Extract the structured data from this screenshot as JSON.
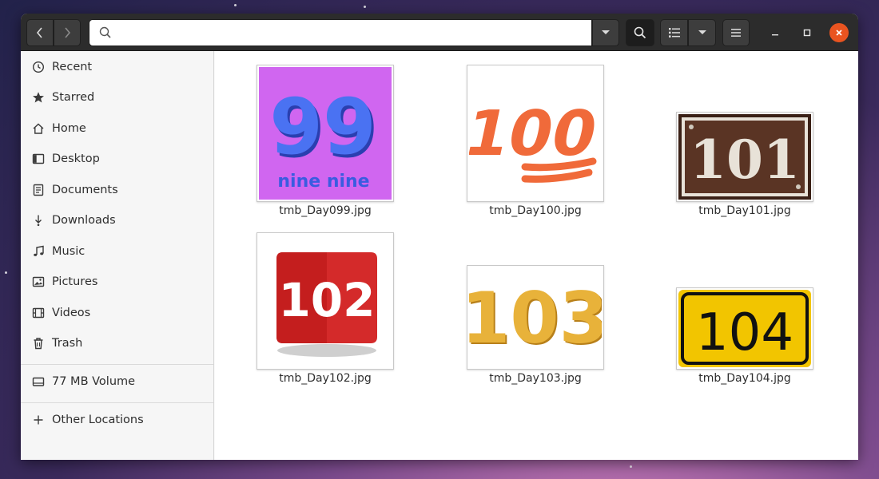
{
  "toolbar": {
    "search_placeholder": ""
  },
  "sidebar": {
    "items": [
      {
        "label": "Recent",
        "icon": "clock-icon"
      },
      {
        "label": "Starred",
        "icon": "star-icon"
      },
      {
        "label": "Home",
        "icon": "home-icon"
      },
      {
        "label": "Desktop",
        "icon": "desktop-icon"
      },
      {
        "label": "Documents",
        "icon": "document-icon"
      },
      {
        "label": "Downloads",
        "icon": "download-icon"
      },
      {
        "label": "Music",
        "icon": "music-icon"
      },
      {
        "label": "Pictures",
        "icon": "pictures-icon"
      },
      {
        "label": "Videos",
        "icon": "video-icon"
      },
      {
        "label": "Trash",
        "icon": "trash-icon"
      }
    ],
    "volume": {
      "label": "77 MB Volume",
      "icon": "drive-icon"
    },
    "other_locations": {
      "label": "Other Locations",
      "icon": "plus-icon"
    }
  },
  "files": [
    {
      "name": "tmb_Day099.jpg",
      "number": "99",
      "caption": "nine nine",
      "bg": "#d066f0",
      "fg": "#3a5ce0"
    },
    {
      "name": "tmb_Day100.jpg",
      "number": "100",
      "bg": "#ffffff",
      "fg": "#f06a3a"
    },
    {
      "name": "tmb_Day101.jpg",
      "number": "101",
      "bg": "#4a2a1c",
      "fg": "#e8e2d8"
    },
    {
      "name": "tmb_Day102.jpg",
      "number": "102",
      "bg": "#ffffff",
      "fg": "#d42a2a"
    },
    {
      "name": "tmb_Day103.jpg",
      "number": "103",
      "bg": "#ffffff",
      "fg": "#e0a830"
    },
    {
      "name": "tmb_Day104.jpg",
      "number": "104",
      "bg": "#f2c500",
      "fg": "#111111"
    }
  ],
  "colors": {
    "accent": "#e95420",
    "headerbar": "#2c2c2c"
  }
}
